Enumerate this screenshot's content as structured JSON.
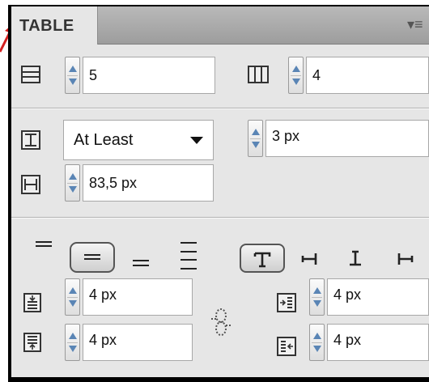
{
  "panel": {
    "tab_label": "TABLE",
    "menu_icon": "panel-menu-icon"
  },
  "rows_cols": {
    "rows_value": "5",
    "columns_value": "4"
  },
  "row_height": {
    "mode_selected": "At Least",
    "height_value": "3 px"
  },
  "column_width": {
    "width_value": "83,5 px"
  },
  "insets": {
    "top_value": "4 px",
    "bottom_value": "4 px",
    "left_value": "4 px",
    "right_value": "4 px"
  },
  "colors": {
    "spinner_arrow": "#5a85b5",
    "panel_bg": "#e6e6e6",
    "tab_bar": "#a9a9a9",
    "callout_arrow": "#d42020"
  }
}
